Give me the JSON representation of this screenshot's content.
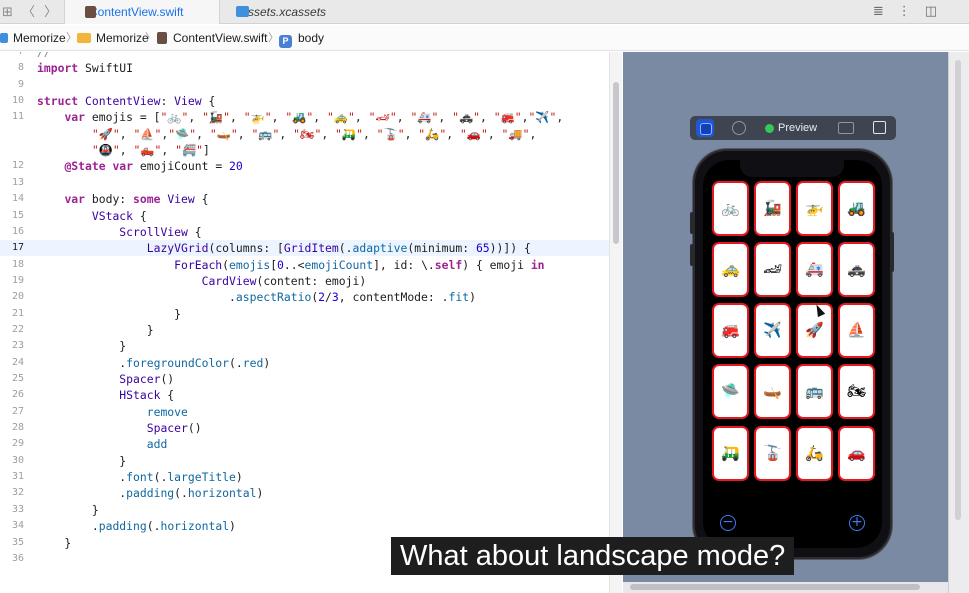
{
  "tabs": [
    {
      "label": "ContentView.swift",
      "active": true
    },
    {
      "label": "Assets.xcassets",
      "active": false
    }
  ],
  "breadcrumb": [
    "Memorize",
    "Memorize",
    "ContentView.swift",
    "body"
  ],
  "code_lines": [
    {
      "n": "7",
      "html": "<span class=\"cmt\">//</span>"
    },
    {
      "n": "8",
      "html": "<span class=\"kw\">import</span> SwiftUI"
    },
    {
      "n": "9",
      "html": ""
    },
    {
      "n": "10",
      "html": "<span class=\"kw\">struct</span> <span class=\"ty\">ContentView</span>: <span class=\"ty\">View</span> {"
    },
    {
      "n": "11",
      "html": "    <span class=\"kw\">var</span> emojis = [<span class=\"st\">\"🚲\"</span>, <span class=\"st\">\"🚂\"</span>, <span class=\"st\">\"🚁\"</span>, <span class=\"st\">\"🚜\"</span>, <span class=\"st\">\"🚕\"</span>, <span class=\"st\">\"🏎\"</span>, <span class=\"st\">\"🚑\"</span>, <span class=\"st\">\"🚓\"</span>, <span class=\"st\">\"🚒\"</span>,<span class=\"st\">\"✈️\"</span>,"
    },
    {
      "n": "",
      "html": "        <span class=\"st\">\"🚀\"</span>, <span class=\"st\">\"⛵️\"</span>,<span class=\"st\">\"🛸\"</span>, <span class=\"st\">\"🛶\"</span>, <span class=\"st\">\"🚌\"</span>, <span class=\"st\">\"🏍\"</span>, <span class=\"st\">\"🛺\"</span>, <span class=\"st\">\"🚡\"</span>, <span class=\"st\">\"🛵\"</span>, <span class=\"st\">\"🚗\"</span>, <span class=\"st\">\"🚚\"</span>,"
    },
    {
      "n": "",
      "html": "        <span class=\"st\">\"🚇\"</span>, <span class=\"st\">\"🛻\"</span>, <span class=\"st\">\"🚝\"</span>]"
    },
    {
      "n": "12",
      "html": "    <span class=\"kw\">@State</span> <span class=\"kw\">var</span> emojiCount = <span class=\"nu\">20</span>"
    },
    {
      "n": "13",
      "html": ""
    },
    {
      "n": "14",
      "html": "    <span class=\"kw\">var</span> body: <span class=\"kw\">some</span> <span class=\"ty\">View</span> {"
    },
    {
      "n": "15",
      "html": "        <span class=\"ty\">VStack</span> {"
    },
    {
      "n": "16",
      "html": "            <span class=\"ty\">ScrollView</span> {"
    },
    {
      "n": "17",
      "html": "                <span class=\"ty\">LazyVGrid</span>(columns: [<span class=\"ty\">GridItem</span>(.<span class=\"pr\">adaptive</span>(minimum: <span class=\"nu\">65</span>))]) {",
      "current": true
    },
    {
      "n": "18",
      "html": "                    <span class=\"ty\">ForEach</span>(<span class=\"pr\">emojis</span>[<span class=\"nu\">0</span>..&lt;<span class=\"pr\">emojiCount</span>], id: \\.<span class=\"kw\">self</span>) { emoji <span class=\"kw\">in</span>"
    },
    {
      "n": "19",
      "html": "                        <span class=\"ty\">CardView</span>(content: emoji)"
    },
    {
      "n": "20",
      "html": "                            .<span class=\"pr\">aspectRatio</span>(<span class=\"nu\">2</span>/<span class=\"nu\">3</span>, contentMode: .<span class=\"pr\">fit</span>)"
    },
    {
      "n": "21",
      "html": "                    }"
    },
    {
      "n": "22",
      "html": "                }"
    },
    {
      "n": "23",
      "html": "            }"
    },
    {
      "n": "24",
      "html": "            .<span class=\"pr\">foregroundColor</span>(.<span class=\"pr\">red</span>)"
    },
    {
      "n": "25",
      "html": "            <span class=\"ty\">Spacer</span>()"
    },
    {
      "n": "26",
      "html": "            <span class=\"ty\">HStack</span> {"
    },
    {
      "n": "27",
      "html": "                <span class=\"pr\">remove</span>"
    },
    {
      "n": "28",
      "html": "                <span class=\"ty\">Spacer</span>()"
    },
    {
      "n": "29",
      "html": "                <span class=\"pr\">add</span>"
    },
    {
      "n": "30",
      "html": "            }"
    },
    {
      "n": "31",
      "html": "            .<span class=\"pr\">font</span>(.<span class=\"pr\">largeTitle</span>)"
    },
    {
      "n": "32",
      "html": "            .<span class=\"pr\">padding</span>(.<span class=\"pr\">horizontal</span>)"
    },
    {
      "n": "33",
      "html": "        }"
    },
    {
      "n": "34",
      "html": "        .<span class=\"pr\">padding</span>(.<span class=\"pr\">horizontal</span>)"
    },
    {
      "n": "35",
      "html": "    }"
    },
    {
      "n": "36",
      "html": ""
    }
  ],
  "preview": {
    "label": "Preview",
    "live_color": "#1e58d8",
    "status_color": "#34c759",
    "card_border_color": "#e5191f",
    "cards": [
      "🚲",
      "🚂",
      "🚁",
      "🚜",
      "🚕",
      "🏎",
      "🚑",
      "🚓",
      "🚒",
      "✈️",
      "🚀",
      "⛵️",
      "🛸",
      "🛶",
      "🚌",
      "🏍",
      "🛺",
      "🚡",
      "🛵",
      "🚗"
    ],
    "remove_icon": "minus-circle-icon",
    "add_icon": "plus-circle-icon"
  },
  "subtitle": "What about landscape mode?"
}
